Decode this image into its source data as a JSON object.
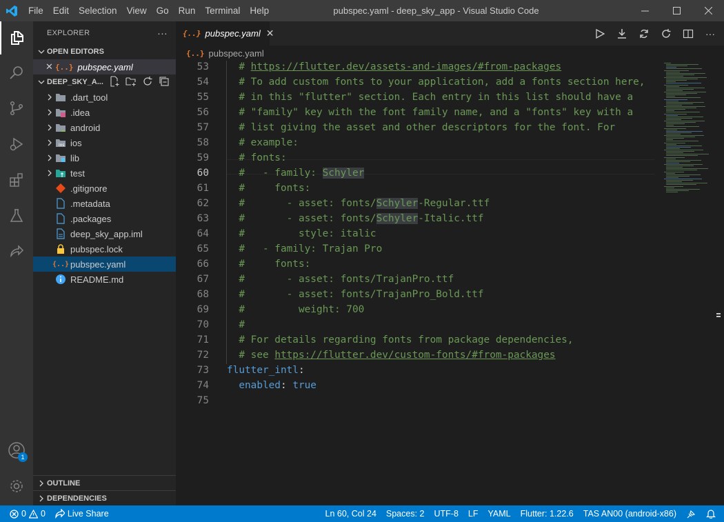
{
  "app": {
    "window_title": "pubspec.yaml - deep_sky_app - Visual Studio Code",
    "logo_icon": "vscode-logo-icon",
    "accent_color": "#007acc"
  },
  "menu": [
    {
      "label": "File"
    },
    {
      "label": "Edit"
    },
    {
      "label": "Selection"
    },
    {
      "label": "View"
    },
    {
      "label": "Go"
    },
    {
      "label": "Run"
    },
    {
      "label": "Terminal"
    },
    {
      "label": "Help"
    }
  ],
  "activity": {
    "items": [
      "explorer-icon",
      "search-icon",
      "source-control-icon",
      "run-debug-icon",
      "extensions-icon",
      "testing-icon",
      "live-share-icon"
    ],
    "accounts_badge": "1"
  },
  "sidebar": {
    "title": "EXPLORER",
    "open_editors_label": "OPEN EDITORS",
    "open_editor_file": "pubspec.yaml",
    "project_label": "DEEP_SKY_A...",
    "tree": [
      {
        "name": ".dart_tool",
        "kind": "folder",
        "icon": "folder-icon"
      },
      {
        "name": ".idea",
        "kind": "folder",
        "icon": "idea-folder-icon"
      },
      {
        "name": "android",
        "kind": "folder",
        "icon": "android-folder-icon"
      },
      {
        "name": "ios",
        "kind": "folder",
        "icon": "ios-folder-icon"
      },
      {
        "name": "lib",
        "kind": "folder",
        "icon": "lib-folder-icon"
      },
      {
        "name": "test",
        "kind": "folder",
        "icon": "test-folder-icon"
      },
      {
        "name": ".gitignore",
        "kind": "file",
        "icon": "git-icon"
      },
      {
        "name": ".metadata",
        "kind": "file",
        "icon": "file-icon"
      },
      {
        "name": ".packages",
        "kind": "file",
        "icon": "file-icon"
      },
      {
        "name": "deep_sky_app.iml",
        "kind": "file",
        "icon": "iml-icon"
      },
      {
        "name": "pubspec.lock",
        "kind": "file",
        "icon": "lock-icon"
      },
      {
        "name": "pubspec.yaml",
        "kind": "file",
        "icon": "yaml-icon",
        "selected": true
      },
      {
        "name": "README.md",
        "kind": "file",
        "icon": "info-icon"
      }
    ],
    "outline_label": "OUTLINE",
    "dependencies_label": "DEPENDENCIES"
  },
  "editor": {
    "tab_label": "pubspec.yaml",
    "breadcrumb": "pubspec.yaml",
    "lines": [
      {
        "n": "53",
        "t": "  # https://flutter.dev/assets-and-images/#from-packages"
      },
      {
        "n": "54",
        "t": "  # To add custom fonts to your application, add a fonts section here,"
      },
      {
        "n": "55",
        "t": "  # in this \"flutter\" section. Each entry in this list should have a"
      },
      {
        "n": "56",
        "t": "  # \"family\" key with the font family name, and a \"fonts\" key with a"
      },
      {
        "n": "57",
        "t": "  # list giving the asset and other descriptors for the font. For"
      },
      {
        "n": "58",
        "t": "  # example:"
      },
      {
        "n": "59",
        "t": "  # fonts:"
      },
      {
        "n": "60",
        "t": "  #   - family: Schyler"
      },
      {
        "n": "61",
        "t": "  #     fonts:"
      },
      {
        "n": "62",
        "t": "  #       - asset: fonts/Schyler-Regular.ttf"
      },
      {
        "n": "63",
        "t": "  #       - asset: fonts/Schyler-Italic.ttf"
      },
      {
        "n": "64",
        "t": "  #         style: italic"
      },
      {
        "n": "65",
        "t": "  #   - family: Trajan Pro"
      },
      {
        "n": "66",
        "t": "  #     fonts:"
      },
      {
        "n": "67",
        "t": "  #       - asset: fonts/TrajanPro.ttf"
      },
      {
        "n": "68",
        "t": "  #       - asset: fonts/TrajanPro_Bold.ttf"
      },
      {
        "n": "69",
        "t": "  #         weight: 700"
      },
      {
        "n": "70",
        "t": "  #"
      },
      {
        "n": "71",
        "t": "  # For details regarding fonts from package dependencies,"
      },
      {
        "n": "72",
        "t": "  # see https://flutter.dev/custom-fonts/#from-packages"
      },
      {
        "n": "73",
        "t": "flutter_intl:"
      },
      {
        "n": "74",
        "t": "  enabled: true"
      },
      {
        "n": "75",
        "t": ""
      }
    ]
  },
  "status": {
    "errors": "0",
    "warnings": "0",
    "live_share": "Live Share",
    "cursor": "Ln 60, Col 24",
    "indent": "Spaces: 2",
    "encoding": "UTF-8",
    "eol": "LF",
    "language": "YAML",
    "flutter": "Flutter: 1.22.6",
    "device": "TAS AN00 (android-x86)"
  }
}
